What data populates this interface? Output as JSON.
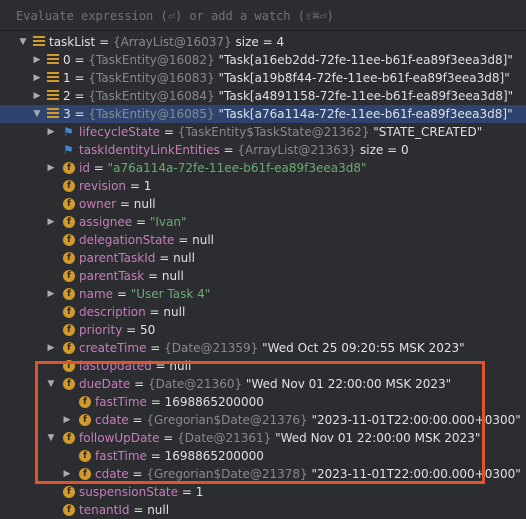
{
  "eval": {
    "placeholder": "Evaluate expression (⏎) or add a watch (⇧⌘⏎)"
  },
  "rows": [
    {
      "name": "taskList",
      "eq": " = ",
      "type": "{ArrayList@16037}",
      "val": "  size = 4"
    },
    {
      "name": "0",
      "eq": " = ",
      "type": "{TaskEntity@16082}",
      "val": " \"Task[a16eb2dd-72fe-11ee-b61f-ea89f3eea3d8]\""
    },
    {
      "name": "1",
      "eq": " = ",
      "type": "{TaskEntity@16083}",
      "val": " \"Task[a19b8f44-72fe-11ee-b61f-ea89f3eea3d8]\""
    },
    {
      "name": "2",
      "eq": " = ",
      "type": "{TaskEntity@16084}",
      "val": " \"Task[a4891158-72fe-11ee-b61f-ea89f3eea3d8]\""
    },
    {
      "name": "3",
      "eq": " = ",
      "type": "{TaskEntity@16085}",
      "val": " \"Task[a76a114a-72fe-11ee-b61f-ea89f3eea3d8]\""
    },
    {
      "name": "lifecycleState",
      "eq": " = ",
      "type": "{TaskEntity$TaskState@21362}",
      "val": " \"STATE_CREATED\""
    },
    {
      "name": "taskIdentityLinkEntities",
      "eq": " = ",
      "type": "{ArrayList@21363}",
      "val": "  size = 0"
    },
    {
      "name": "id",
      "eq": " = ",
      "type": "",
      "str": "\"a76a114a-72fe-11ee-b61f-ea89f3eea3d8\""
    },
    {
      "name": "revision",
      "eq": " = ",
      "val": "1"
    },
    {
      "name": "owner",
      "eq": " = ",
      "val": "null"
    },
    {
      "name": "assignee",
      "eq": " = ",
      "str": "\"Ivan\""
    },
    {
      "name": "delegationState",
      "eq": " = ",
      "val": "null"
    },
    {
      "name": "parentTaskId",
      "eq": " = ",
      "val": "null"
    },
    {
      "name": "parentTask",
      "eq": " = ",
      "val": "null"
    },
    {
      "name": "name",
      "eq": " = ",
      "str": "\"User Task 4\""
    },
    {
      "name": "description",
      "eq": " = ",
      "val": "null"
    },
    {
      "name": "priority",
      "eq": " = ",
      "val": "50"
    },
    {
      "name": "createTime",
      "eq": " = ",
      "type": "{Date@21359}",
      "val": " \"Wed Oct 25 09:20:55 MSK 2023\""
    },
    {
      "name": "lastUpdated",
      "eq": " = ",
      "val": "null"
    },
    {
      "name": "dueDate",
      "eq": " = ",
      "type": "{Date@21360}",
      "val": " \"Wed Nov 01 22:00:00 MSK 2023\""
    },
    {
      "name": "fastTime",
      "eq": " = ",
      "val": "1698865200000"
    },
    {
      "name": "cdate",
      "eq": " = ",
      "type": "{Gregorian$Date@21376}",
      "val": " \"2023-11-01T22:00:00.000+0300\""
    },
    {
      "name": "followUpDate",
      "eq": " = ",
      "type": "{Date@21361}",
      "val": " \"Wed Nov 01 22:00:00 MSK 2023\""
    },
    {
      "name": "fastTime",
      "eq": " = ",
      "val": "1698865200000"
    },
    {
      "name": "cdate",
      "eq": " = ",
      "type": "{Gregorian$Date@21378}",
      "val": " \"2023-11-01T22:00:00.000+0300\""
    },
    {
      "name": "suspensionState",
      "eq": " = ",
      "val": "1"
    },
    {
      "name": "tenantId",
      "eq": " = ",
      "val": "null"
    }
  ]
}
